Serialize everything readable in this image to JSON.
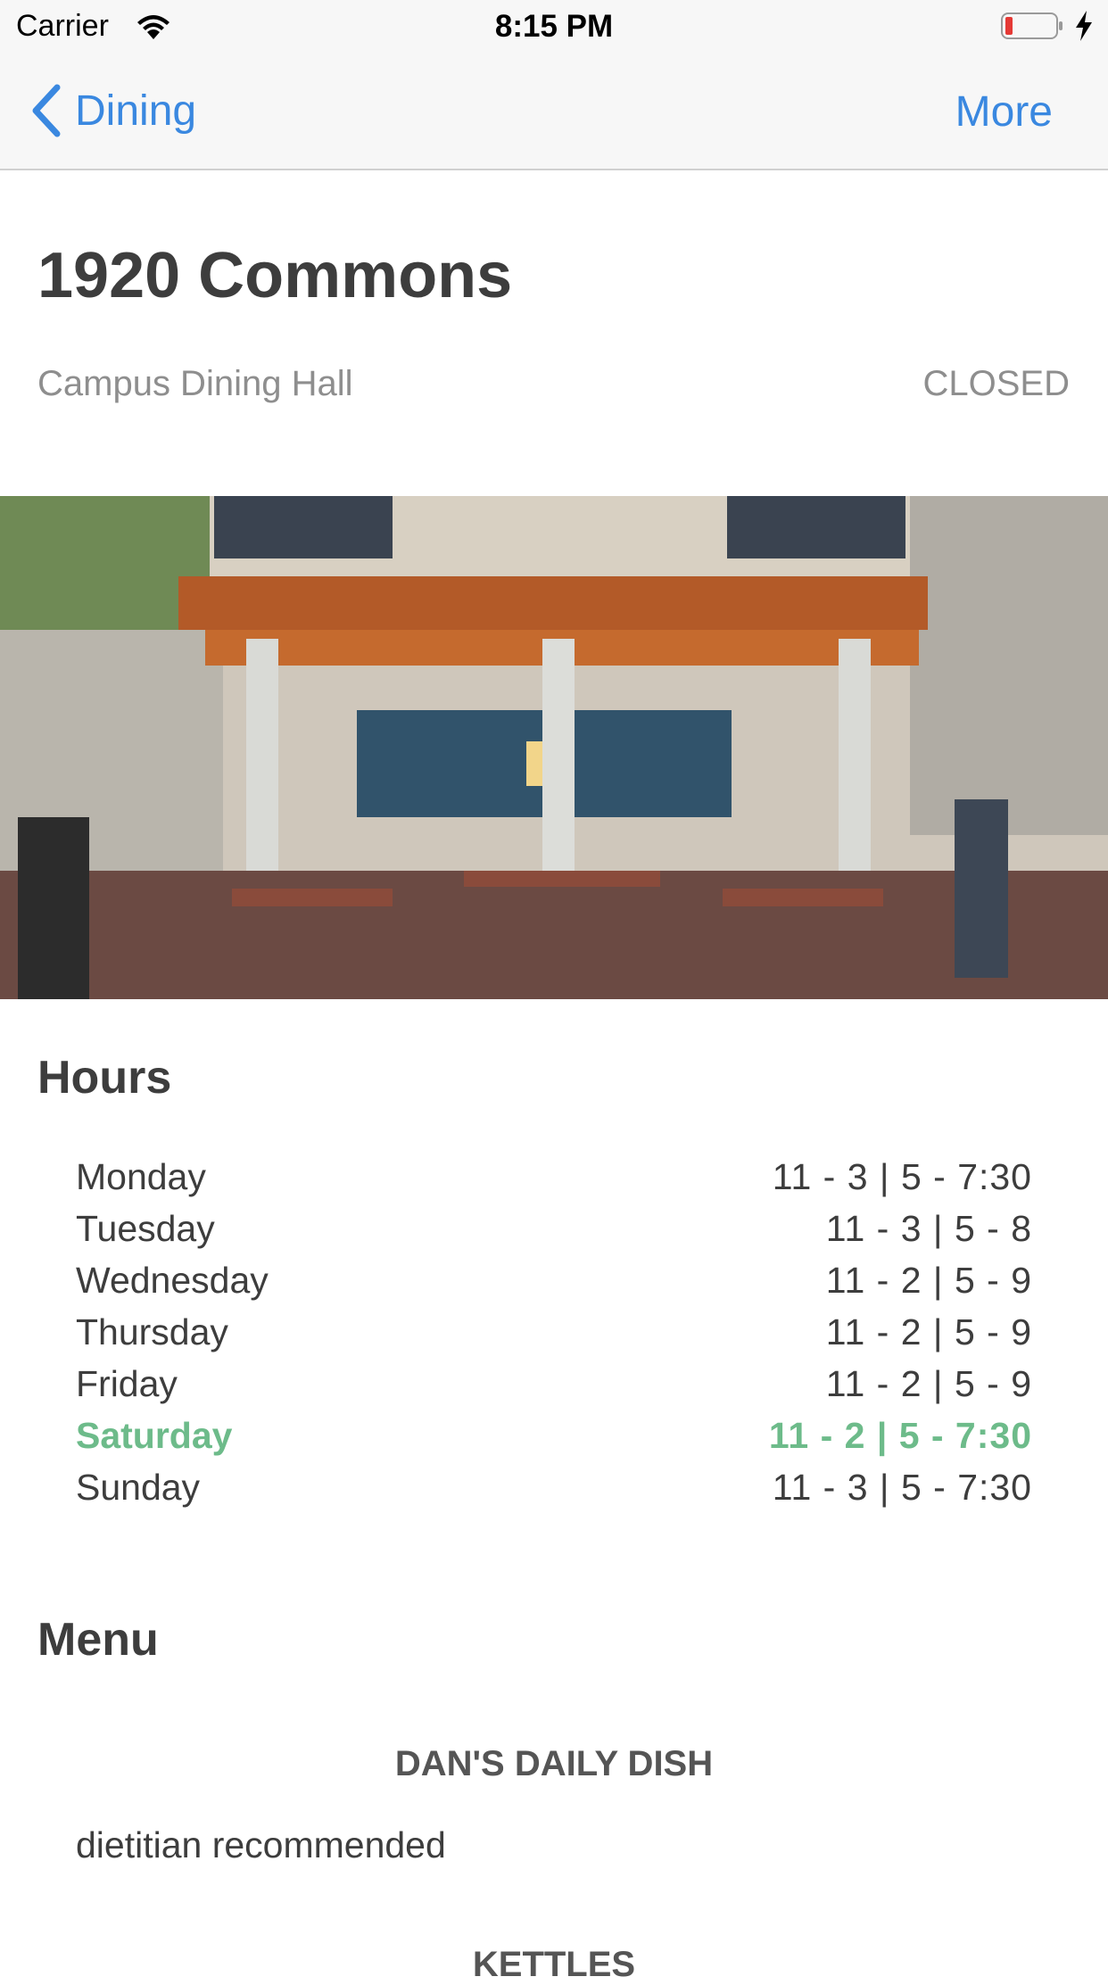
{
  "status_bar": {
    "carrier": "Carrier",
    "time": "8:15 PM"
  },
  "nav": {
    "back_label": "Dining",
    "right_button": "More"
  },
  "venue": {
    "name": "1920 Commons",
    "type": "Campus Dining Hall",
    "status": "CLOSED"
  },
  "hours": {
    "heading": "Hours",
    "days": [
      {
        "day": "Monday",
        "hours": "11 - 3  |  5 - 7:30"
      },
      {
        "day": "Tuesday",
        "hours": "11 - 3  |  5 - 8"
      },
      {
        "day": "Wednesday",
        "hours": "11 - 2  |  5 - 9"
      },
      {
        "day": "Thursday",
        "hours": "11 - 2  |  5 - 9"
      },
      {
        "day": "Friday",
        "hours": "11 - 2  |  5 - 9"
      },
      {
        "day": "Saturday",
        "hours": "11 - 2  |  5 - 7:30"
      },
      {
        "day": "Sunday",
        "hours": "11 - 3  |  5 - 7:30"
      }
    ]
  },
  "menu": {
    "heading": "Menu",
    "stations": [
      {
        "name": "DAN'S DAILY DISH",
        "items": [
          "dietitian recommended"
        ]
      },
      {
        "name": "KETTLES",
        "items": []
      }
    ]
  },
  "colors": {
    "accent": "#3a88e0",
    "today": "#6dbb8a",
    "battery_low": "#e53935"
  }
}
